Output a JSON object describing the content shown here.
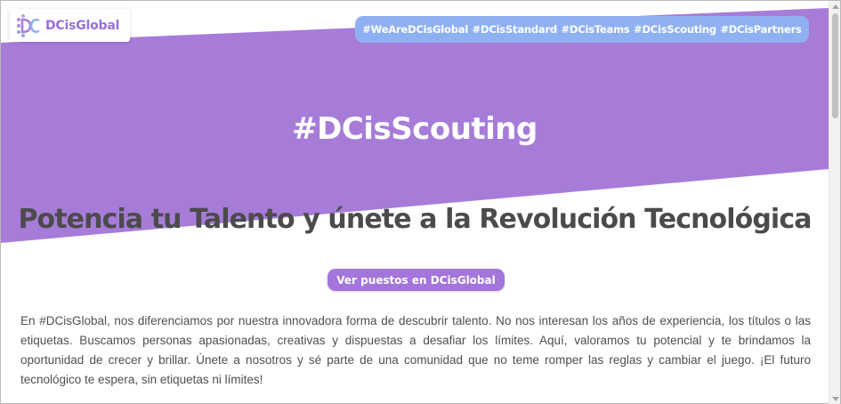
{
  "brand": {
    "name": "DCisGlobal",
    "logo_icon": "dc-monogram-icon"
  },
  "colors": {
    "hero_purple": "#a77cd9",
    "nav_blue": "#8fb0f2",
    "button_purple": "#a475db",
    "headline_gray": "#4b4b4b"
  },
  "nav": {
    "items": [
      {
        "label": "#WeAreDCisGlobal"
      },
      {
        "label": "#DCisStandard"
      },
      {
        "label": "#DCisTeams"
      },
      {
        "label": "#DCisScouting"
      },
      {
        "label": "#DCisPartners"
      }
    ]
  },
  "hero": {
    "title": "#DCisScouting"
  },
  "main": {
    "headline": "Potencia tu Talento y únete a la Revolución Tecnológica",
    "cta_label": "Ver puestos en DCisGlobal",
    "intro": "En #DCisGlobal, nos diferenciamos por nuestra innovadora forma de descubrir talento. No nos interesan los años de experiencia, los títulos o las etiquetas. Buscamos personas apasionadas, creativas y dispuestas a desafiar los límites. Aquí, valoramos tu potencial y te brindamos la oportunidad de crecer y brillar. Únete a nosotros y sé parte de una comunidad que no teme romper las reglas y cambiar el juego. ¡El futuro tecnológico te espera, sin etiquetas ni límites!"
  }
}
